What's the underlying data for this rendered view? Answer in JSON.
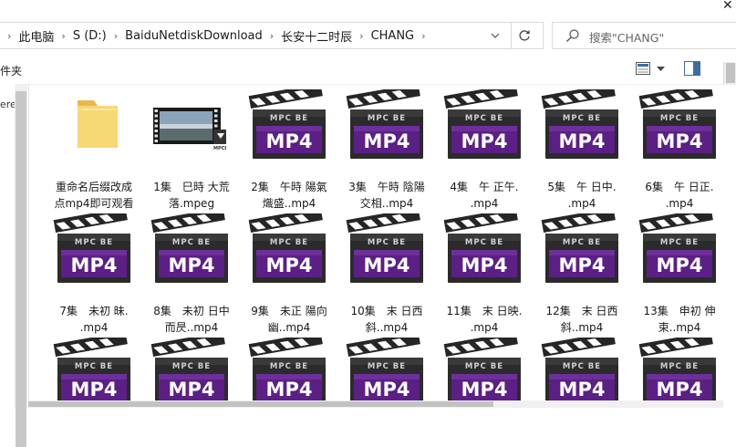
{
  "window": {
    "close_glyph": "✕"
  },
  "address": {
    "segments": [
      "此电脑",
      "S (D:)",
      "BaiduNetdiskDownload",
      "长安十二时辰",
      "CHANG"
    ],
    "dropdown_icon": "chevron-down-icon",
    "refresh_icon": "refresh-icon"
  },
  "search": {
    "placeholder": "搜索\"CHANG\""
  },
  "command_bar": {
    "label": "件夹"
  },
  "nav_pane": {
    "stub_label": "ere"
  },
  "files": [
    {
      "type": "folder",
      "lines": [
        "重命名后缀改成",
        "点mp4即可观看"
      ]
    },
    {
      "type": "video",
      "lines": [
        "1集　巳時 大荒",
        "落.mpeg"
      ]
    },
    {
      "type": "mp4",
      "lines": [
        "2集　午時 陽氣",
        "熾盛..mp4"
      ]
    },
    {
      "type": "mp4",
      "lines": [
        "3集　午時 陰陽",
        "交相..mp4"
      ]
    },
    {
      "type": "mp4",
      "lines": [
        "4集　午 正午.",
        ".mp4"
      ]
    },
    {
      "type": "mp4",
      "lines": [
        "5集　午 日中.",
        ".mp4"
      ]
    },
    {
      "type": "mp4",
      "lines": [
        "6集　午 日正.",
        ".mp4"
      ]
    },
    {
      "type": "mp4",
      "lines": [
        "7集　未初 昧.",
        ".mp4"
      ]
    },
    {
      "type": "mp4",
      "lines": [
        "8集　未初 日中",
        "而昃..mp4"
      ]
    },
    {
      "type": "mp4",
      "lines": [
        "9集　未正 陽向",
        "幽..mp4"
      ]
    },
    {
      "type": "mp4",
      "lines": [
        "10集　末 日西",
        "斜..mp4"
      ]
    },
    {
      "type": "mp4",
      "lines": [
        "11集　末 日映.",
        ".mp4"
      ]
    },
    {
      "type": "mp4",
      "lines": [
        "12集　末 日西",
        "斜..mp4"
      ]
    },
    {
      "type": "mp4",
      "lines": [
        "13集　申初 伸",
        "束..mp4"
      ]
    },
    {
      "type": "mp4",
      "lines": [
        "",
        ""
      ]
    },
    {
      "type": "mp4",
      "lines": [
        "",
        ""
      ]
    },
    {
      "type": "mp4",
      "lines": [
        "",
        ""
      ]
    },
    {
      "type": "mp4",
      "lines": [
        "",
        ""
      ]
    },
    {
      "type": "mp4",
      "lines": [
        "",
        ""
      ]
    },
    {
      "type": "mp4",
      "lines": [
        "",
        ""
      ]
    },
    {
      "type": "mp4",
      "lines": [
        "",
        ""
      ]
    }
  ],
  "mp4_icon": {
    "brand": "MPC BE",
    "format": "MP4",
    "accent": "#5b1f86"
  },
  "video_icon": {
    "brand": "MPCBE"
  }
}
